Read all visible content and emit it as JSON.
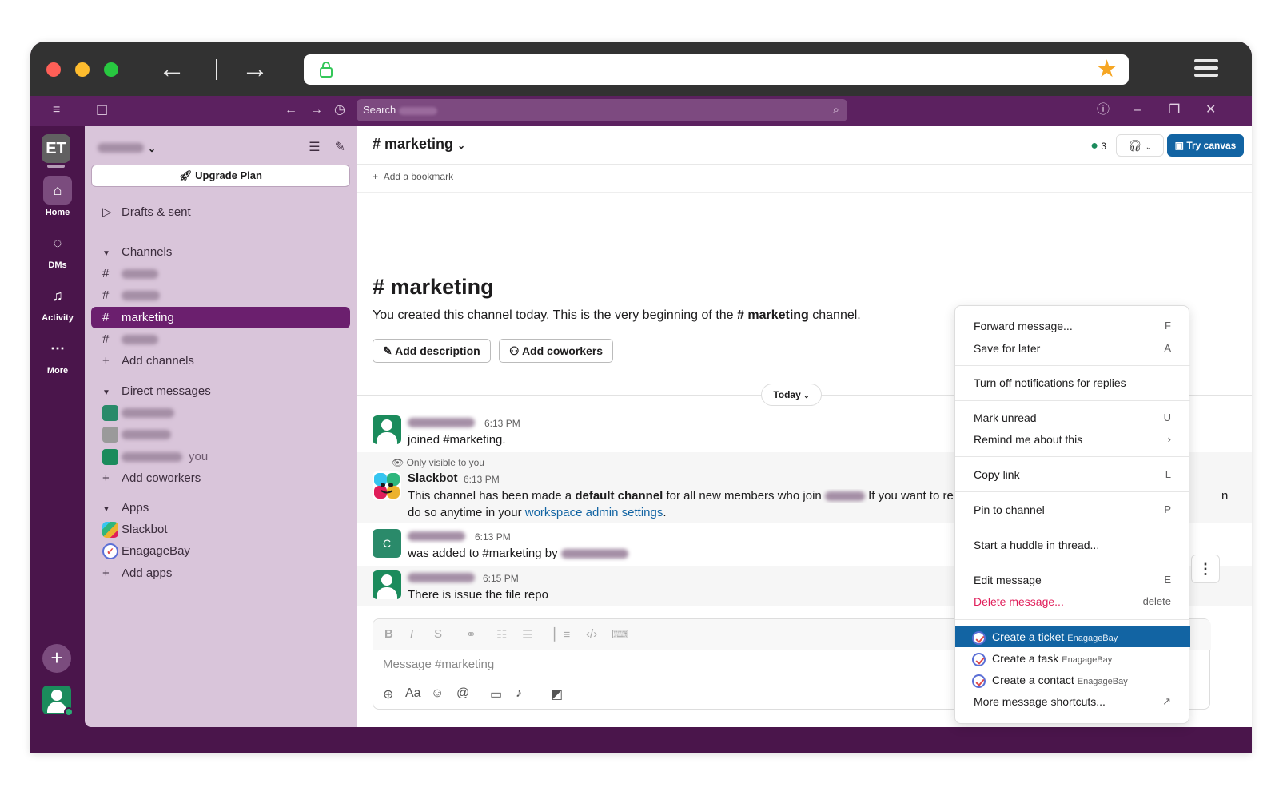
{
  "search": {
    "label": "Search"
  },
  "rail": {
    "workspace_initials": "ET",
    "items": [
      {
        "label": "Home",
        "icon": "home-icon"
      },
      {
        "label": "DMs",
        "icon": "dm-icon"
      },
      {
        "label": "Activity",
        "icon": "bell-icon"
      },
      {
        "label": "More",
        "icon": "more-icon"
      }
    ]
  },
  "sidebar": {
    "upgrade_label": "Upgrade Plan",
    "drafts_label": "Drafts & sent",
    "channels_header": "Channels",
    "active_channel": "marketing",
    "add_channels": "Add channels",
    "dm_header": "Direct messages",
    "you_label": "you",
    "add_coworkers": "Add coworkers",
    "apps_header": "Apps",
    "apps": [
      "Slackbot",
      "EnagageBay"
    ],
    "add_apps": "Add apps"
  },
  "channel": {
    "name": "marketing",
    "member_count": "3",
    "try_canvas": "Try canvas",
    "add_bookmark": "Add a bookmark",
    "intro_text_before": "You created this channel today. This is the very beginning of the ",
    "intro_channel": "# marketing",
    "intro_text_after": " channel.",
    "add_description": "Add description",
    "add_coworkers": "Add coworkers",
    "today_label": "Today"
  },
  "messages": [
    {
      "time": "6:13 PM",
      "text": "joined #marketing."
    },
    {
      "visibility": "Only visible to you",
      "sender": "Slackbot",
      "time": "6:13 PM",
      "text_a": "This channel has been made a ",
      "text_bold": "default channel",
      "text_b": " for all new members who join ",
      "text_c": " If you want to remove",
      "line2_a": "do so anytime in your ",
      "line2_link": "workspace admin settings",
      "line2_b": ".",
      "overflow": "n"
    },
    {
      "avatar_letter": "C",
      "time": "6:13 PM",
      "text": "was added to #marketing by"
    },
    {
      "time": "6:15 PM",
      "text": "There is issue the file repo"
    }
  ],
  "composer": {
    "placeholder": "Message #marketing",
    "text_style_label": "Aa"
  },
  "context_menu": {
    "items": [
      {
        "label": "Forward message...",
        "key": "F"
      },
      {
        "label": "Save for later",
        "key": "A"
      },
      {
        "label": "Turn off notifications for replies",
        "key": ""
      },
      {
        "label": "Mark unread",
        "key": "U"
      },
      {
        "label": "Remind me about this",
        "key": "›"
      },
      {
        "label": "Copy link",
        "key": "L"
      },
      {
        "label": "Pin to channel",
        "key": "P"
      },
      {
        "label": "Start a huddle in thread...",
        "key": ""
      },
      {
        "label": "Edit message",
        "key": "E"
      },
      {
        "label": "Delete message...",
        "key": "delete"
      },
      {
        "label": "Create a ticket",
        "sub": "EnagageBay"
      },
      {
        "label": "Create a task",
        "sub": "EnagageBay"
      },
      {
        "label": "Create a contact",
        "sub": "EnagageBay"
      },
      {
        "label": "More message shortcuts...",
        "key": "↗"
      }
    ]
  },
  "colors": {
    "aubergine": "#4a154b",
    "active": "#6b1f6e",
    "link": "#1264a3",
    "danger": "#e01e5a"
  }
}
